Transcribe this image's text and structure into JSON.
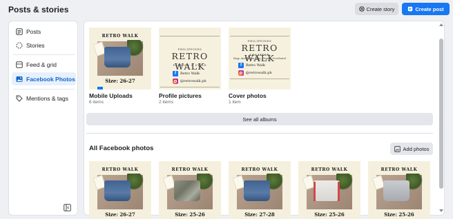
{
  "header": {
    "title": "Posts & stories",
    "create_story_label": "Create story",
    "create_post_label": "Create post"
  },
  "sidebar": {
    "items": [
      {
        "label": "Posts",
        "icon": "posts-icon",
        "active": false
      },
      {
        "label": "Stories",
        "icon": "stories-icon",
        "active": false
      },
      {
        "label": "Feed & grid",
        "icon": "feed-grid-icon",
        "active": false
      },
      {
        "label": "Facebook Photos",
        "icon": "photo-icon",
        "active": true
      },
      {
        "label": "Mentions & tags",
        "icon": "tag-icon",
        "active": false
      }
    ],
    "collapse_icon": "collapse-sidebar-icon"
  },
  "albums": [
    {
      "name": "Mobile Uploads",
      "count": "6 items",
      "thumb": {
        "brand": "RETRO WALK",
        "size": "Size: 26-27"
      }
    },
    {
      "name": "Profile pictures",
      "count": "2 items",
      "thumb": {
        "top": "PHILIPPINES",
        "brand": "RETRO WALK",
        "tagline": "FASHION & STYLE",
        "fb": "Retro Walk",
        "ig": "@retrowalk.ph"
      }
    },
    {
      "name": "Cover photos",
      "count": "1 item",
      "thumb": {
        "top": "PHILIPPINES",
        "brand": "RETRO WALK",
        "location_label": "LOCATION",
        "location": "Brgy. Andulauan, Bag. Negros Occidental",
        "fb": "Retro Walk",
        "ig": "@retrowalk.ph"
      }
    }
  ],
  "see_all_label": "See all albums",
  "all_photos": {
    "title": "All Facebook photos",
    "add_label": "Add photos",
    "items": [
      {
        "brand": "RETRO WALK",
        "size": "Size: 26-27",
        "style": "blue"
      },
      {
        "brand": "RETRO WALK",
        "size": "Size: 25-26",
        "style": "camo"
      },
      {
        "brand": "RETRO WALK",
        "size": "Size: 27-28",
        "style": "blue"
      },
      {
        "brand": "RETRO WALK",
        "size": "Size: 25-26",
        "style": "white"
      },
      {
        "brand": "RETRO WALK",
        "size": "Size: 25-26",
        "style": "grey"
      }
    ]
  },
  "colors": {
    "accent": "#1877f2",
    "active_bg": "#e7f0fd",
    "page_bg": "#eef0f3"
  }
}
